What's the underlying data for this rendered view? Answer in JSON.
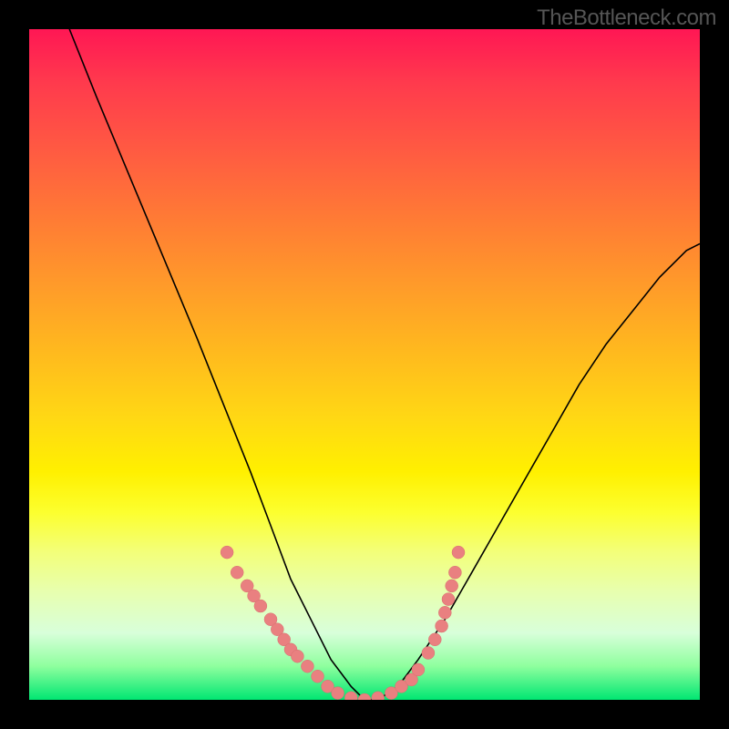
{
  "watermark": "TheBottleneck.com",
  "chart_data": {
    "type": "line",
    "title": "",
    "xlabel": "",
    "ylabel": "",
    "xlim": [
      0,
      100
    ],
    "ylim": [
      0,
      100
    ],
    "series": [
      {
        "name": "curve",
        "x": [
          6,
          10,
          15,
          20,
          25,
          29,
          33,
          36,
          39,
          42,
          45,
          48,
          50,
          52,
          55,
          58,
          62,
          66,
          70,
          74,
          78,
          82,
          86,
          90,
          94,
          98,
          100
        ],
        "y": [
          100,
          90,
          78,
          66,
          54,
          44,
          34,
          26,
          18,
          12,
          6,
          2,
          0,
          0,
          2,
          6,
          12,
          19,
          26,
          33,
          40,
          47,
          53,
          58,
          63,
          67,
          68
        ]
      }
    ],
    "scatter": {
      "name": "dots",
      "points": [
        {
          "x": 29.5,
          "y": 22
        },
        {
          "x": 31,
          "y": 19
        },
        {
          "x": 32.5,
          "y": 17
        },
        {
          "x": 33.5,
          "y": 15.5
        },
        {
          "x": 34.5,
          "y": 14
        },
        {
          "x": 36,
          "y": 12
        },
        {
          "x": 37,
          "y": 10.5
        },
        {
          "x": 38,
          "y": 9
        },
        {
          "x": 39,
          "y": 7.5
        },
        {
          "x": 40,
          "y": 6.5
        },
        {
          "x": 41.5,
          "y": 5
        },
        {
          "x": 43,
          "y": 3.5
        },
        {
          "x": 44.5,
          "y": 2
        },
        {
          "x": 46,
          "y": 1
        },
        {
          "x": 48,
          "y": 0.3
        },
        {
          "x": 50,
          "y": 0
        },
        {
          "x": 52,
          "y": 0.3
        },
        {
          "x": 54,
          "y": 1
        },
        {
          "x": 55.5,
          "y": 2
        },
        {
          "x": 57,
          "y": 3
        },
        {
          "x": 58,
          "y": 4.5
        },
        {
          "x": 59.5,
          "y": 7
        },
        {
          "x": 60.5,
          "y": 9
        },
        {
          "x": 61.5,
          "y": 11
        },
        {
          "x": 62,
          "y": 13
        },
        {
          "x": 62.5,
          "y": 15
        },
        {
          "x": 63,
          "y": 17
        },
        {
          "x": 63.5,
          "y": 19
        },
        {
          "x": 64,
          "y": 22
        }
      ]
    },
    "gradient_stops": [
      {
        "pos": 0,
        "color": "#ff1754"
      },
      {
        "pos": 50,
        "color": "#ffd814"
      },
      {
        "pos": 100,
        "color": "#00e672"
      }
    ]
  }
}
